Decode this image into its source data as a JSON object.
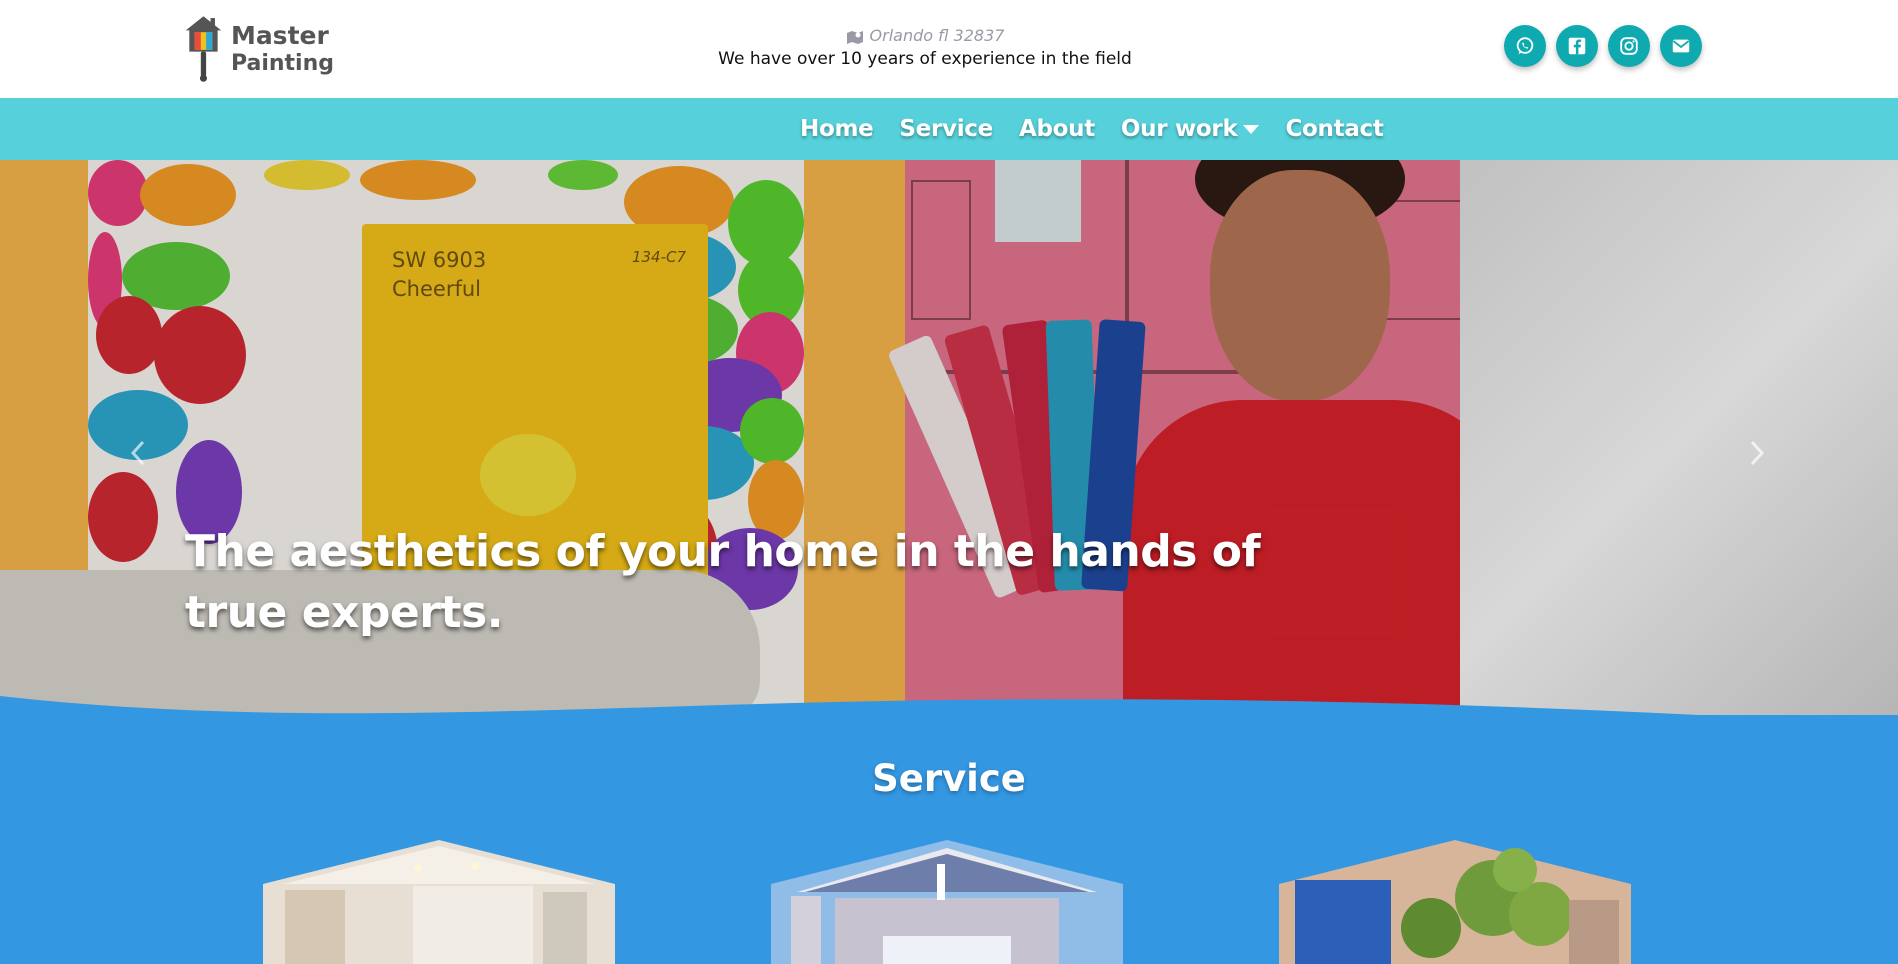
{
  "header": {
    "logo": {
      "line1": "Master",
      "line2": "Painting"
    },
    "location": "Orlando fl 32837",
    "tagline": "We have over 10 years of experience in the field",
    "socials": [
      {
        "name": "whatsapp",
        "icon": "whatsapp-icon"
      },
      {
        "name": "facebook",
        "icon": "facebook-icon"
      },
      {
        "name": "instagram",
        "icon": "instagram-icon"
      },
      {
        "name": "email",
        "icon": "envelope-icon"
      }
    ],
    "accent_color": "#0fa9b0"
  },
  "nav": {
    "background": "#56d1db",
    "items": [
      {
        "label": "Home"
      },
      {
        "label": "Service"
      },
      {
        "label": "About"
      },
      {
        "label": "Our work",
        "has_dropdown": true
      },
      {
        "label": "Contact"
      }
    ]
  },
  "hero": {
    "caption": "The aesthetics of your home in the hands of true experts.",
    "chip_code": "SW 6903",
    "chip_name": "Cheerful",
    "chip_number": "134-C7",
    "prev_icon": "chevron-left-icon",
    "next_icon": "chevron-right-icon"
  },
  "service": {
    "title": "Service",
    "background": "#3497e2",
    "cards": [
      {
        "image": "interior-room"
      },
      {
        "image": "house-exterior"
      },
      {
        "image": "garden-painter"
      }
    ]
  }
}
